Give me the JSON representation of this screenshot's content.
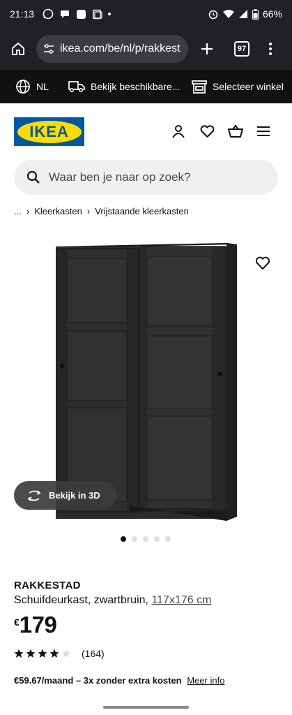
{
  "status_bar": {
    "time": "21:13",
    "battery": "66%",
    "left_icons": [
      "whatsapp-icon",
      "messages-icon",
      "app-icon",
      "screenshot-icon",
      "dot-icon"
    ],
    "right_icons": [
      "alarm-icon",
      "wifi-icon",
      "signal-icon",
      "battery-icon"
    ]
  },
  "browser": {
    "url": "ikea.com/be/nl/p/rakkest",
    "tab_count": "97"
  },
  "info_bar": {
    "language": "NL",
    "stock": "Bekijk beschikbare...",
    "store": "Selecteer winkel"
  },
  "header": {
    "logo_text": "IKEA",
    "icons": [
      "user-icon",
      "heart-icon",
      "basket-icon",
      "menu-icon"
    ]
  },
  "search": {
    "placeholder": "Waar ben je naar op zoek?"
  },
  "breadcrumb": {
    "items": [
      "...",
      "Kleerkasten",
      "Vrijstaande kleerkasten"
    ]
  },
  "product": {
    "view3d_label": "Bekijk in 3D",
    "image_count": 5,
    "active_image": 1,
    "name": "RAKKESTAD",
    "description": "Schuifdeurkast, zwartbruin,",
    "size": "117x176 cm",
    "currency": "€",
    "price": "179",
    "rating_value": 4,
    "rating_max": 5,
    "review_count": "(164)",
    "finance_text": "€59.67/maand – 3x zonder extra kosten",
    "finance_link": "Meer info",
    "colors": {
      "wardrobe": "#2b2b2b",
      "brand_blue": "#0058a3",
      "brand_yellow": "#ffdb00"
    }
  }
}
